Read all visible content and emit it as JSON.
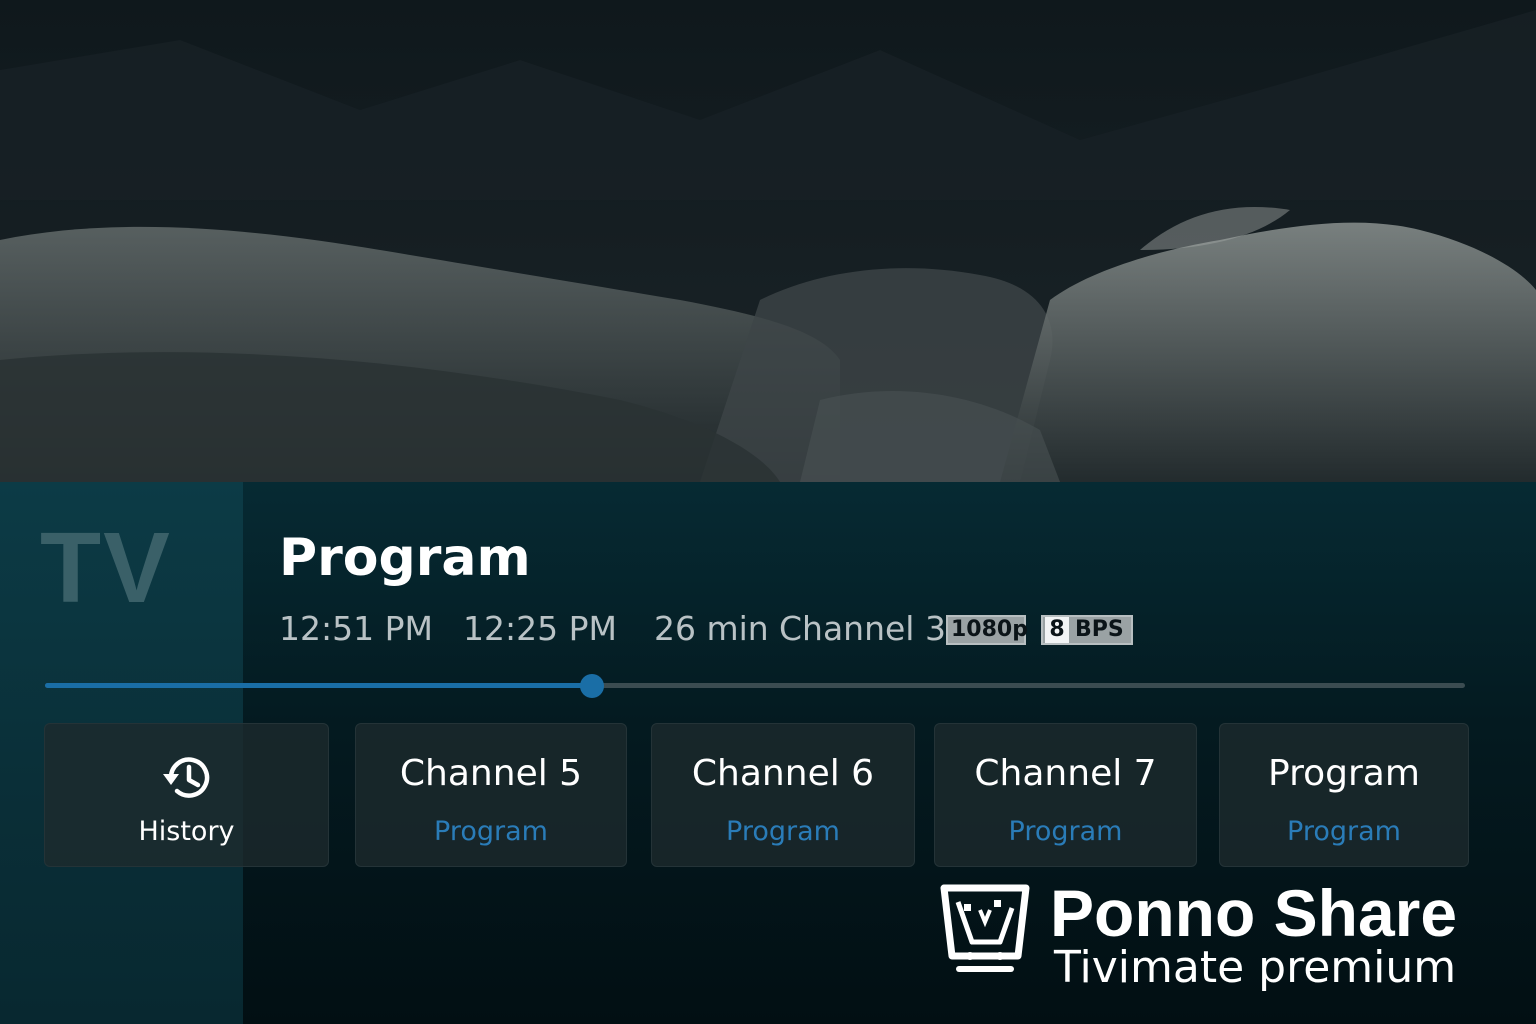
{
  "player": {
    "side_label": "TV",
    "program_title": "Program",
    "start_time": "12:51 PM",
    "end_time": "12:25 PM",
    "duration": "26 min",
    "channel": "Channel 3",
    "resolution_badge": "1080p",
    "bps_number": "8",
    "bps_label": "BPS",
    "progress": 0.385,
    "accent_color": "#1a6ea6"
  },
  "tiles": {
    "history": {
      "label": "History",
      "icon": "history-icon"
    },
    "items": [
      {
        "title": "Channel 5",
        "subtitle": "Program"
      },
      {
        "title": "Channel 6",
        "subtitle": "Program"
      },
      {
        "title": "Channel 7",
        "subtitle": "Program"
      },
      {
        "title": "Program",
        "subtitle": "Program"
      }
    ]
  },
  "watermark": {
    "name": "Ponno Share",
    "tagline": "Tivimate premium",
    "icon": "shopping-cart-icon"
  }
}
